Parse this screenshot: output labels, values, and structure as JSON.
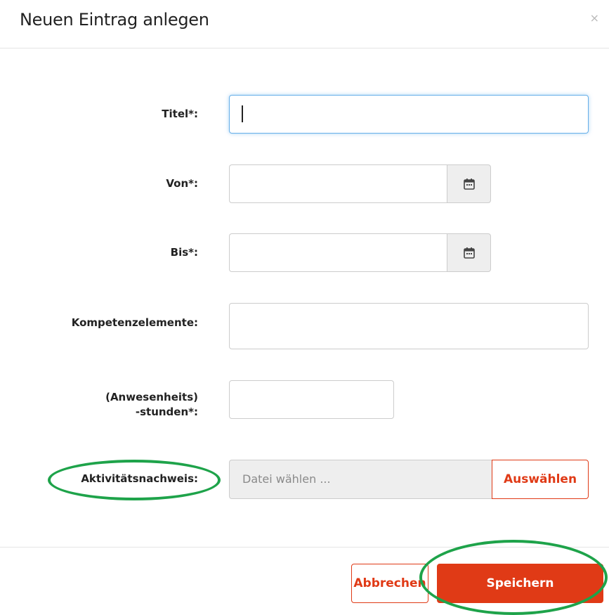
{
  "dialog": {
    "title": "Neuen Eintrag anlegen",
    "close_icon": "×"
  },
  "form": {
    "titel_label": "Titel*:",
    "titel_value": "",
    "von_label": "Von*:",
    "bis_label": "Bis*:",
    "kompetenz_label": "Kompetenzelemente:",
    "stunden_label_line1": "(Anwesenheits)",
    "stunden_label_line2": "-stunden*:",
    "aktivitaet_label": "Aktivitätsnachweis:",
    "file_placeholder": "Datei wählen ...",
    "file_button": "Auswählen"
  },
  "footer": {
    "cancel_label": "Abbrechen",
    "save_label": "Speichern"
  },
  "colors": {
    "accent": "#e03a16",
    "highlight": "#1ea34a",
    "focus": "#66afe9"
  }
}
